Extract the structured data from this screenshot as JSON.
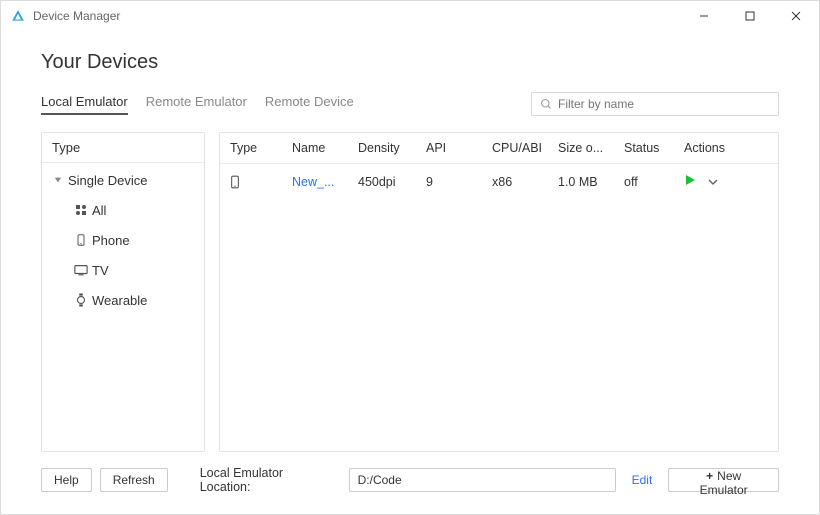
{
  "titlebar": {
    "title": "Device Manager"
  },
  "page": {
    "heading": "Your Devices"
  },
  "tabs": {
    "items": [
      {
        "label": "Local Emulator",
        "active": true
      },
      {
        "label": "Remote Emulator",
        "active": false
      },
      {
        "label": "Remote Device",
        "active": false
      }
    ]
  },
  "filter": {
    "placeholder": "Filter by name"
  },
  "sidebar": {
    "header": "Type",
    "group": {
      "label": "Single Device"
    },
    "items": [
      {
        "icon": "grid",
        "label": "All"
      },
      {
        "icon": "phone",
        "label": "Phone"
      },
      {
        "icon": "tv",
        "label": "TV"
      },
      {
        "icon": "watch",
        "label": "Wearable"
      }
    ]
  },
  "table": {
    "headers": {
      "type": "Type",
      "name": "Name",
      "density": "Density",
      "api": "API",
      "cpu": "CPU/ABI",
      "size": "Size o...",
      "status": "Status",
      "actions": "Actions"
    },
    "rows": [
      {
        "type_icon": "phone",
        "name": "New_...",
        "density": "450dpi",
        "api": "9",
        "cpu": "x86",
        "size": "1.0 MB",
        "status": "off"
      }
    ]
  },
  "footer": {
    "help": "Help",
    "refresh": "Refresh",
    "location_label": "Local Emulator Location:",
    "location_value": "D:/Code",
    "edit": "Edit",
    "new_emulator": "New Emulator"
  }
}
